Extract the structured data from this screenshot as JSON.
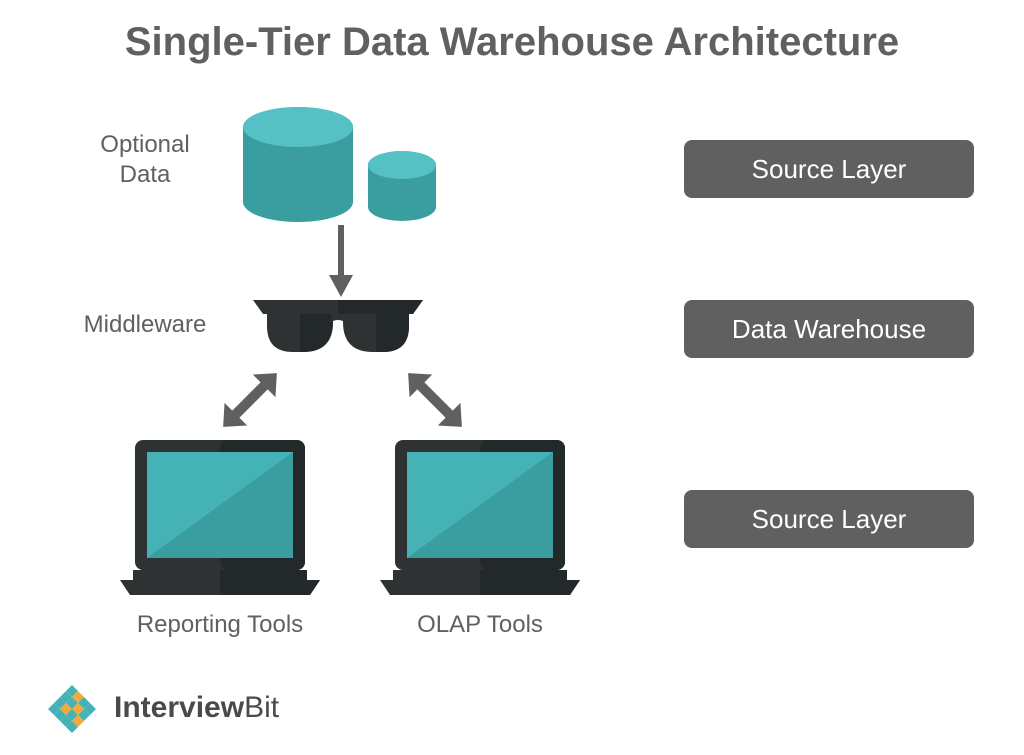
{
  "title": "Single-Tier Data Warehouse Architecture",
  "labels": {
    "optional_data_line1": "Optional",
    "optional_data_line2": "Data",
    "middleware": "Middleware",
    "reporting_tools": "Reporting Tools",
    "olap_tools": "OLAP Tools"
  },
  "layers": {
    "source_top": "Source Layer",
    "warehouse": "Data Warehouse",
    "source_bottom": "Source Layer"
  },
  "logo": {
    "brand_bold": "Interview",
    "brand_rest": "Bit"
  },
  "colors": {
    "teal": "#45b2b5",
    "teal_dark": "#3a9ea1",
    "gray": "#606060",
    "dark": "#2f3233",
    "darker": "#23282a",
    "orange": "#f3a93b"
  }
}
